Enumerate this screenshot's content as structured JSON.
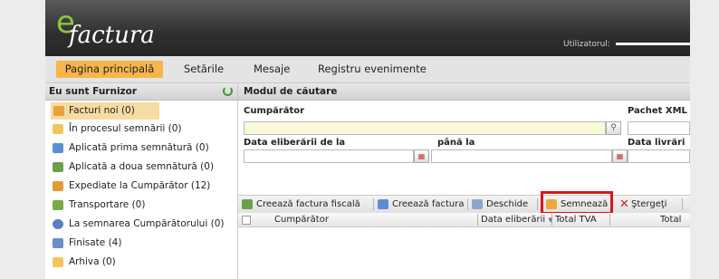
{
  "header": {
    "logo_e": "e",
    "logo_text": "factura",
    "user_label": "Utilizatorul:"
  },
  "menu": {
    "items": [
      {
        "label": "Pagina principală",
        "active": true
      },
      {
        "label": "Setările",
        "active": false
      },
      {
        "label": "Mesaje",
        "active": false
      },
      {
        "label": "Registru evenimente",
        "active": false
      }
    ]
  },
  "sidebar": {
    "title": "Eu sunt Furnizor",
    "items": [
      {
        "label": "Facturi noi (0)",
        "icon": "invoice-icon",
        "color": "#e8a23a"
      },
      {
        "label": "În procesul semnării (0)",
        "icon": "folder-icon",
        "color": "#f2c55c"
      },
      {
        "label": "Aplicată prima semnătură (0)",
        "icon": "signature-doc-icon",
        "color": "#5a8fd6"
      },
      {
        "label": "Aplicată a doua semnătură (0)",
        "icon": "signature-doc-icon",
        "color": "#6aa04a"
      },
      {
        "label": "Expediate la Cumpărător (12)",
        "icon": "send-icon",
        "color": "#e39a34"
      },
      {
        "label": "Transportare (0)",
        "icon": "truck-icon",
        "color": "#7aa94a"
      },
      {
        "label": "La semnarea Cumpărătorului (0)",
        "icon": "globe-icon",
        "color": "#5b7fbf"
      },
      {
        "label": "Finisate (4)",
        "icon": "check-doc-icon",
        "color": "#6b8ec7"
      },
      {
        "label": "Arhiva (0)",
        "icon": "folder-icon",
        "color": "#f2c55c"
      }
    ]
  },
  "search": {
    "title": "Modul de căutare",
    "buyer_label": "Cumpărător",
    "xml_label": "Pachet XML",
    "date_from_label": "Data eliberării de la",
    "date_to_label": "până la",
    "delivery_label": "Data livrări"
  },
  "toolbar": {
    "create_fiscal": "Creează factura fiscală",
    "create_invoice": "Creează factura",
    "open": "Deschide",
    "sign": "Semnează",
    "delete": "Ştergeţi"
  },
  "grid": {
    "columns": [
      "Cumpărător",
      "Data eliberării",
      "Total TVA",
      "Total"
    ]
  },
  "colors": {
    "accent": "#f6b64b",
    "highlight": "#d9161c",
    "logo_green": "#8ec63f"
  }
}
